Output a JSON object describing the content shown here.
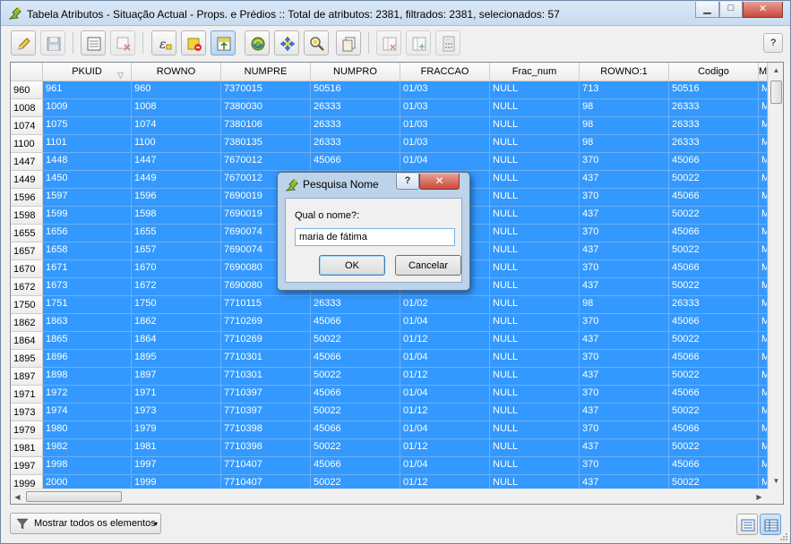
{
  "window": {
    "title": "Tabela Atributos - Situação Actual - Props. e Prédios :: Total de atributos: 2381, filtrados: 2381, selecionados: 57",
    "controls": {
      "minimize": "▁",
      "maximize": "□",
      "close": "✕"
    }
  },
  "toolbar": {
    "buttons": [
      {
        "name": "toggle-editing",
        "icon": "pencil-icon",
        "enabled": true
      },
      {
        "name": "save-edits",
        "icon": "save-icon",
        "enabled": false
      },
      {
        "name": "new-attribute",
        "icon": "new-field-icon",
        "enabled": true
      },
      {
        "name": "delete-attribute",
        "icon": "delete-field-icon",
        "enabled": false
      },
      {
        "name": "select-by-expression",
        "icon": "expression-icon",
        "enabled": true
      },
      {
        "name": "unselect-all",
        "icon": "deselect-icon",
        "enabled": true
      },
      {
        "name": "move-selection-to-top",
        "icon": "move-top-icon",
        "enabled": true
      },
      {
        "name": "invert-selection",
        "icon": "invert-icon",
        "enabled": true
      },
      {
        "name": "pan-to-selection",
        "icon": "pan-icon",
        "enabled": true
      },
      {
        "name": "zoom-to-selection",
        "icon": "zoom-icon",
        "enabled": true
      },
      {
        "name": "copy-rows",
        "icon": "copy-icon",
        "enabled": true
      },
      {
        "name": "delete-column",
        "icon": "delete-column-icon",
        "enabled": false
      },
      {
        "name": "new-column",
        "icon": "new-column-icon",
        "enabled": false
      },
      {
        "name": "field-calculator",
        "icon": "calculator-icon",
        "enabled": false
      }
    ],
    "help_label": "?"
  },
  "table": {
    "columns": [
      "PKUID",
      "ROWNO",
      "NUMPRE",
      "NUMPRO",
      "FRACCAO",
      "Frac_num",
      "ROWNO:1",
      "Codigo",
      "M"
    ],
    "sort_indicator": "▽",
    "rows": [
      {
        "header": "960",
        "cells": [
          "961",
          "960",
          "7370015",
          "50516",
          "01/03",
          "NULL",
          "713",
          "50516",
          "M"
        ]
      },
      {
        "header": "1008",
        "cells": [
          "1009",
          "1008",
          "7380030",
          "26333",
          "01/03",
          "NULL",
          "98",
          "26333",
          "M"
        ]
      },
      {
        "header": "1074",
        "cells": [
          "1075",
          "1074",
          "7380106",
          "26333",
          "01/03",
          "NULL",
          "98",
          "26333",
          "M"
        ]
      },
      {
        "header": "1100",
        "cells": [
          "1101",
          "1100",
          "7380135",
          "26333",
          "01/03",
          "NULL",
          "98",
          "26333",
          "M"
        ]
      },
      {
        "header": "1447",
        "cells": [
          "1448",
          "1447",
          "7670012",
          "45066",
          "01/04",
          "NULL",
          "370",
          "45066",
          "M"
        ]
      },
      {
        "header": "1449",
        "cells": [
          "1450",
          "1449",
          "7670012",
          "",
          "",
          "NULL",
          "437",
          "50022",
          "M"
        ]
      },
      {
        "header": "1596",
        "cells": [
          "1597",
          "1596",
          "7690019",
          "",
          "",
          "NULL",
          "370",
          "45066",
          "M"
        ]
      },
      {
        "header": "1598",
        "cells": [
          "1599",
          "1598",
          "7690019",
          "",
          "",
          "NULL",
          "437",
          "50022",
          "M"
        ]
      },
      {
        "header": "1655",
        "cells": [
          "1656",
          "1655",
          "7690074",
          "",
          "",
          "NULL",
          "370",
          "45066",
          "M"
        ]
      },
      {
        "header": "1657",
        "cells": [
          "1658",
          "1657",
          "7690074",
          "",
          "",
          "NULL",
          "437",
          "50022",
          "M"
        ]
      },
      {
        "header": "1670",
        "cells": [
          "1671",
          "1670",
          "7690080",
          "",
          "",
          "NULL",
          "370",
          "45066",
          "M"
        ]
      },
      {
        "header": "1672",
        "cells": [
          "1673",
          "1672",
          "7690080",
          "",
          "",
          "NULL",
          "437",
          "50022",
          "M"
        ]
      },
      {
        "header": "1750",
        "cells": [
          "1751",
          "1750",
          "7710115",
          "26333",
          "01/02",
          "NULL",
          "98",
          "26333",
          "M"
        ]
      },
      {
        "header": "1862",
        "cells": [
          "1863",
          "1862",
          "7710269",
          "45066",
          "01/04",
          "NULL",
          "370",
          "45066",
          "M"
        ]
      },
      {
        "header": "1864",
        "cells": [
          "1865",
          "1864",
          "7710269",
          "50022",
          "01/12",
          "NULL",
          "437",
          "50022",
          "M"
        ]
      },
      {
        "header": "1895",
        "cells": [
          "1896",
          "1895",
          "7710301",
          "45066",
          "01/04",
          "NULL",
          "370",
          "45066",
          "M"
        ]
      },
      {
        "header": "1897",
        "cells": [
          "1898",
          "1897",
          "7710301",
          "50022",
          "01/12",
          "NULL",
          "437",
          "50022",
          "M"
        ]
      },
      {
        "header": "1971",
        "cells": [
          "1972",
          "1971",
          "7710397",
          "45066",
          "01/04",
          "NULL",
          "370",
          "45066",
          "M"
        ]
      },
      {
        "header": "1973",
        "cells": [
          "1974",
          "1973",
          "7710397",
          "50022",
          "01/12",
          "NULL",
          "437",
          "50022",
          "M"
        ]
      },
      {
        "header": "1979",
        "cells": [
          "1980",
          "1979",
          "7710398",
          "45066",
          "01/04",
          "NULL",
          "370",
          "45066",
          "M"
        ]
      },
      {
        "header": "1981",
        "cells": [
          "1982",
          "1981",
          "7710398",
          "50022",
          "01/12",
          "NULL",
          "437",
          "50022",
          "M"
        ]
      },
      {
        "header": "1997",
        "cells": [
          "1998",
          "1997",
          "7710407",
          "45066",
          "01/04",
          "NULL",
          "370",
          "45066",
          "M"
        ]
      },
      {
        "header": "1999",
        "cells": [
          "2000",
          "1999",
          "7710407",
          "50022",
          "01/12",
          "NULL",
          "437",
          "50022",
          "M"
        ]
      }
    ],
    "scroll_arrows": {
      "up": "▲",
      "down": "▼",
      "left": "◀",
      "right": "▶"
    }
  },
  "bottom": {
    "filter_button_label": "Mostrar todos os elementos",
    "dropdown_arrow": "▾"
  },
  "dialog": {
    "title": "Pesquisa Nome",
    "help": "?",
    "close": "✕",
    "prompt": "Qual o nome?:",
    "input_value": "maria de fátima",
    "ok_label": "OK",
    "cancel_label": "Cancelar"
  },
  "colors": {
    "selection": "#3399ff",
    "titlebar": "#c9dbef",
    "close_button": "#c9483a"
  }
}
